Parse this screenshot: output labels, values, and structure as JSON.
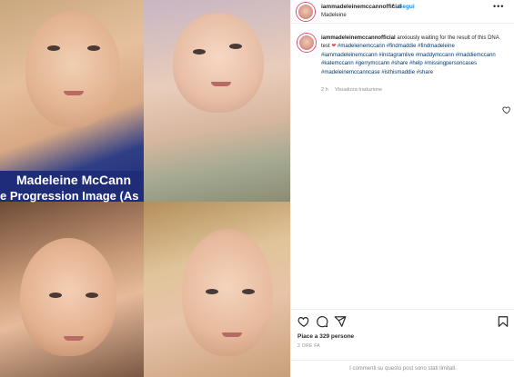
{
  "media": {
    "caption_name": "Madeleine McCann",
    "caption_sub": "e Progression Image (As"
  },
  "header": {
    "username": "iammadeleinemccannofficial",
    "separator": "•",
    "follow_label": "Segui",
    "location": "Madeleine",
    "more_label": "•••"
  },
  "post": {
    "username": "iammadeleinemccannofficial",
    "text_before_heart": "anxiously waiting for the result of this DNA test",
    "hashtags": "#madeleinemccann #findmaddie #findmadeleine #iammadeleinemccann #instagramlive #maddymccann #maddiemccann #katemccann #gerrymccann #share #help #missingpersoncases #madeleinemccanncase #isthismaddie #share",
    "age": "2 h",
    "translation_label": "Visualizza traduzione"
  },
  "footer": {
    "likes": "Piace a 329 persone",
    "date": "2 ORE FA",
    "comments_disabled": "I commenti su questo post sono stati limitati."
  },
  "icons": {
    "heart": "heart-icon",
    "comment": "comment-icon",
    "share": "share-icon",
    "save": "bookmark-icon"
  },
  "colors": {
    "link": "#0095f6",
    "hashtag": "#00376b",
    "red_heart": "#ed4956"
  }
}
